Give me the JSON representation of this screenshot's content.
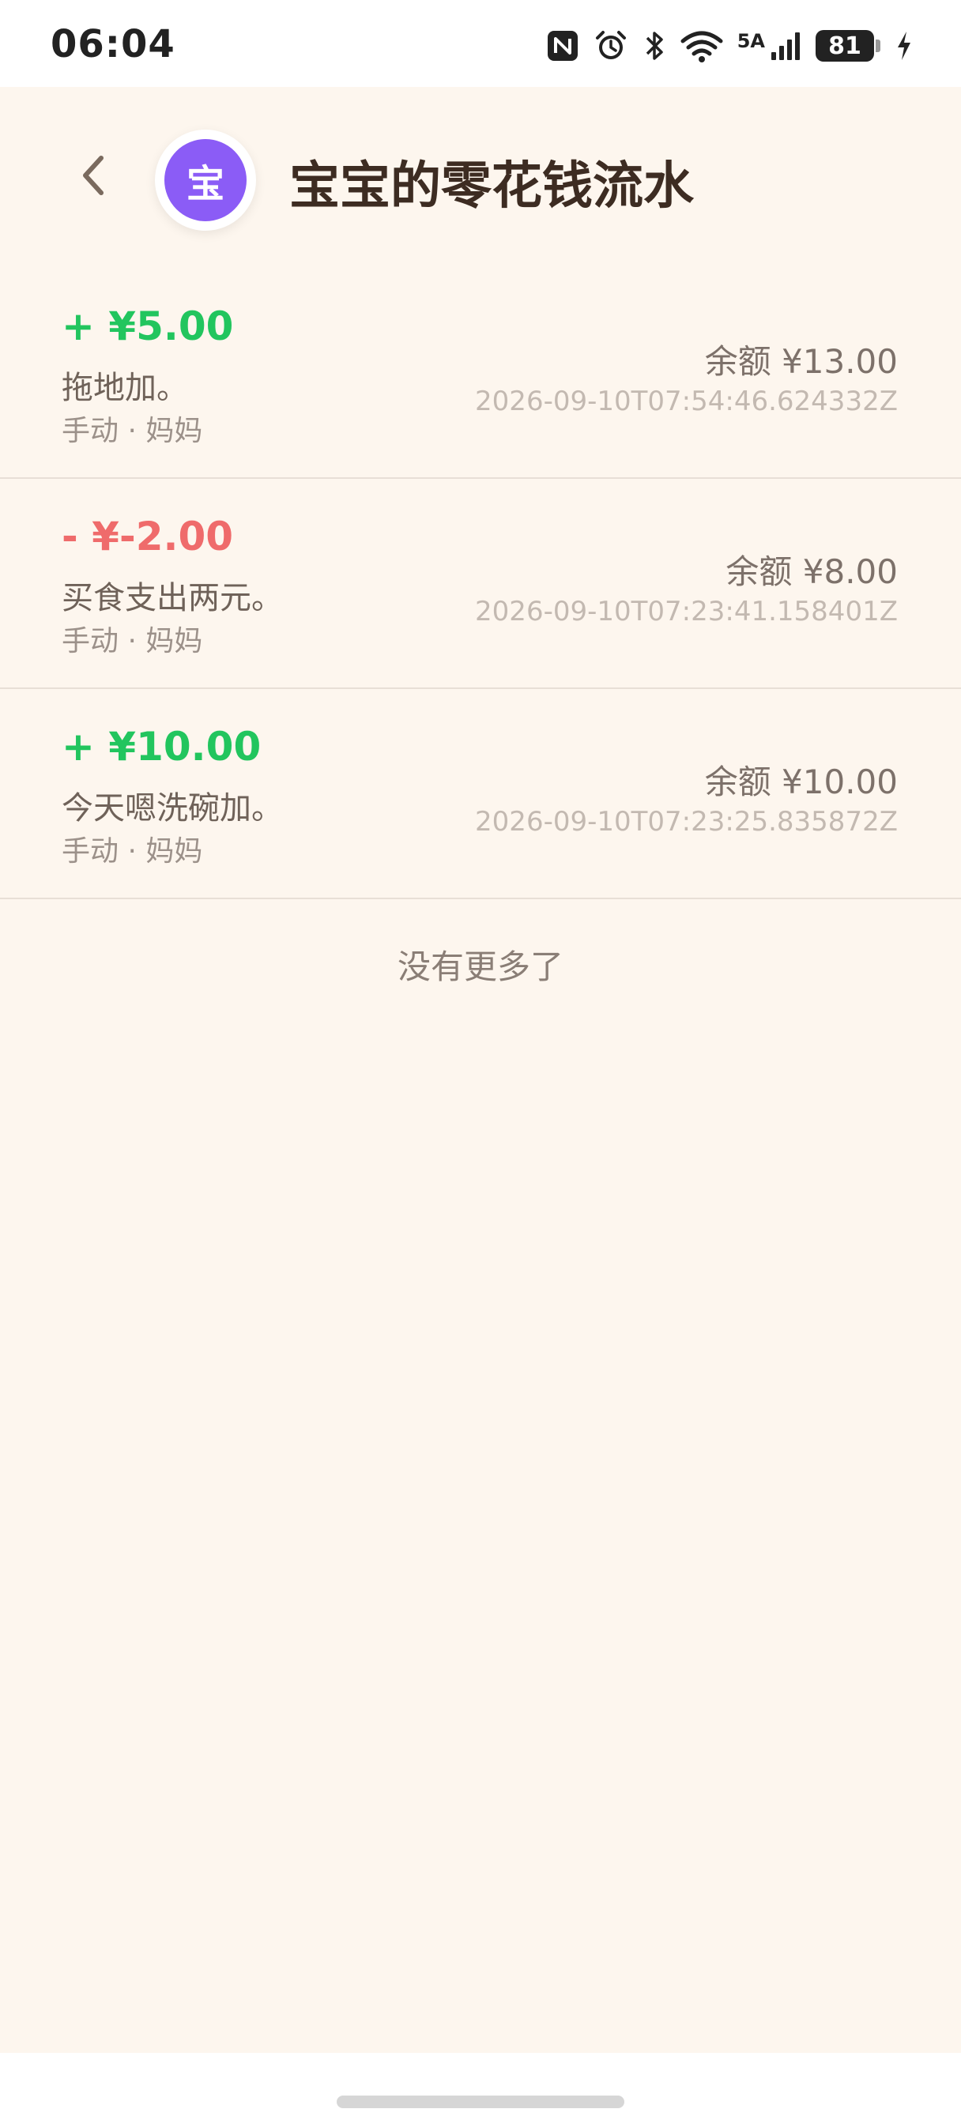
{
  "status_bar": {
    "time": "06:04",
    "network": "5A",
    "battery": "81"
  },
  "header": {
    "avatar_char": "宝",
    "title": "宝宝的零花钱流水"
  },
  "transactions": [
    {
      "amount": "+ ¥5.00",
      "type": "income",
      "note": "拖地加。",
      "meta": "手动 · 妈妈",
      "balance": "余额 ¥13.00",
      "timestamp": "2026-09-10T07:54:46.624332Z"
    },
    {
      "amount": "- ¥-2.00",
      "type": "expense",
      "note": "买食支出两元。",
      "meta": "手动 · 妈妈",
      "balance": "余额 ¥8.00",
      "timestamp": "2026-09-10T07:23:41.158401Z"
    },
    {
      "amount": "+ ¥10.00",
      "type": "income",
      "note": "今天嗯洗碗加。",
      "meta": "手动 · 妈妈",
      "balance": "余额 ¥10.00",
      "timestamp": "2026-09-10T07:23:25.835872Z"
    }
  ],
  "footer": {
    "no_more": "没有更多了"
  },
  "colors": {
    "income": "#22c55e",
    "expense": "#ef6b6b",
    "avatar": "#8b5cf6",
    "background": "#fdf6ee"
  },
  "icons": {
    "back": "chevron-left-icon",
    "nfc": "nfc-icon",
    "alarm": "alarm-icon",
    "bluetooth": "bluetooth-icon",
    "wifi": "wifi-icon",
    "signal": "signal-icon",
    "charging": "charging-icon"
  }
}
